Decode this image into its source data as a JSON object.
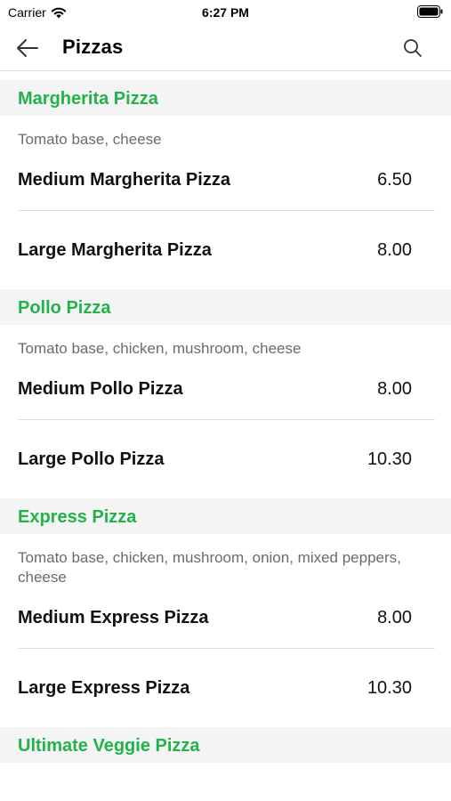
{
  "status_bar": {
    "carrier": "Carrier",
    "time": "6:27 PM"
  },
  "nav": {
    "title": "Pizzas",
    "back_icon": "arrow-left-icon",
    "search_icon": "search-icon"
  },
  "colors": {
    "accent": "#22b24c",
    "section_bg": "#f4f4f4",
    "description": "#6b6b6b"
  },
  "sections": [
    {
      "title": "Margherita Pizza",
      "description": "Tomato base, cheese",
      "items": [
        {
          "name": "Medium Margherita Pizza",
          "price": "6.50"
        },
        {
          "name": "Large Margherita Pizza",
          "price": "8.00"
        }
      ]
    },
    {
      "title": "Pollo Pizza",
      "description": "Tomato base, chicken, mushroom, cheese",
      "items": [
        {
          "name": "Medium Pollo Pizza",
          "price": "8.00"
        },
        {
          "name": "Large Pollo Pizza",
          "price": "10.30"
        }
      ]
    },
    {
      "title": "Express Pizza",
      "description": "Tomato base, chicken, mushroom, onion, mixed peppers, cheese",
      "items": [
        {
          "name": "Medium Express Pizza",
          "price": "8.00"
        },
        {
          "name": "Large Express Pizza",
          "price": "10.30"
        }
      ]
    },
    {
      "title": "Ultimate Veggie Pizza"
    }
  ]
}
